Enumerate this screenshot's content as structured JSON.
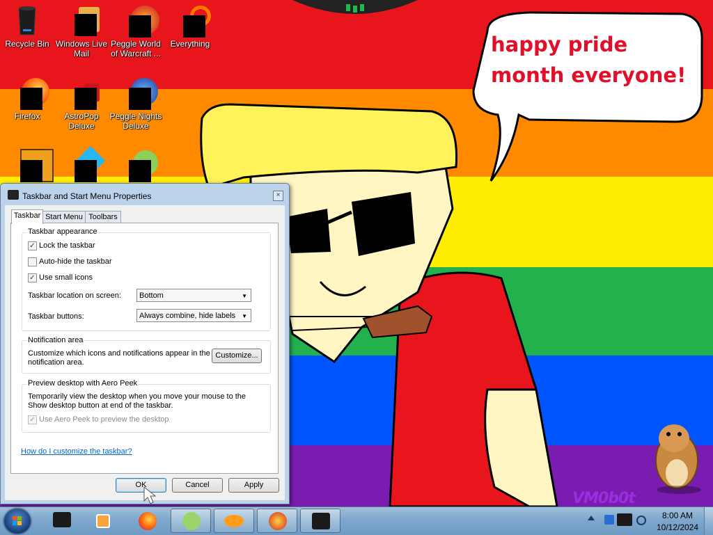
{
  "wallpaper": {
    "speech_text": "happy pride month everyone!",
    "watermark": "VM0b0t",
    "stripe_colors": [
      "#e8161c",
      "#ff8a00",
      "#ffee00",
      "#22b14c",
      "#0055ff",
      "#7a1cb0"
    ]
  },
  "desktop_icons": [
    {
      "label": "Recycle Bin",
      "icon": "recycle-bin-icon"
    },
    {
      "label": "Windows Live Mail",
      "icon": "mail-icon"
    },
    {
      "label": "Peggle World of Warcraft ...",
      "icon": "peggle-icon"
    },
    {
      "label": "Everything",
      "icon": "search-icon"
    },
    {
      "label": "Firefox",
      "icon": "firefox-icon"
    },
    {
      "label": "AstroPop Deluxe",
      "icon": "astropop-icon"
    },
    {
      "label": "Peggle Nights Deluxe",
      "icon": "peggle-nights-icon"
    }
  ],
  "dialog": {
    "title": "Taskbar and Start Menu Properties",
    "close_glyph": "×",
    "tabs": [
      "Taskbar",
      "Start Menu",
      "Toolbars"
    ],
    "active_tab": "Taskbar",
    "appearance": {
      "heading": "Taskbar appearance",
      "lock_label": "Lock the taskbar",
      "lock_checked": true,
      "autohide_label": "Auto-hide the taskbar",
      "autohide_checked": false,
      "small_icons_label": "Use small icons",
      "small_icons_checked": true,
      "location_label": "Taskbar location on screen:",
      "location_value": "Bottom",
      "buttons_label": "Taskbar buttons:",
      "buttons_value": "Always combine, hide labels"
    },
    "notification": {
      "heading": "Notification area",
      "description": "Customize which icons and notifications appear in the notification area.",
      "customize_label": "Customize..."
    },
    "aero_peek": {
      "heading": "Preview desktop with Aero Peek",
      "description": "Temporarily view the desktop when you move your mouse to the Show desktop button at end of the taskbar.",
      "use_label": "Use Aero Peek to preview the desktop",
      "use_checked": true,
      "use_enabled": false
    },
    "help_link": "How do I customize the taskbar?",
    "buttons": {
      "ok": "OK",
      "cancel": "Cancel",
      "apply": "Apply"
    }
  },
  "taskbar": {
    "items": [
      {
        "name": "vm-app",
        "icon": "monitor-icon"
      },
      {
        "name": "media-player",
        "icon": "media-player-icon"
      },
      {
        "name": "firefox",
        "icon": "firefox-icon"
      },
      {
        "name": "plants-vs-zombies",
        "icon": "plant-icon"
      },
      {
        "name": "insaniquarium",
        "icon": "fish-icon"
      },
      {
        "name": "peggle",
        "icon": "peggle-icon"
      },
      {
        "name": "taskbar-properties",
        "icon": "monitor-icon"
      }
    ],
    "clock": {
      "time": "8:00 AM",
      "date": "10/12/2024"
    }
  }
}
